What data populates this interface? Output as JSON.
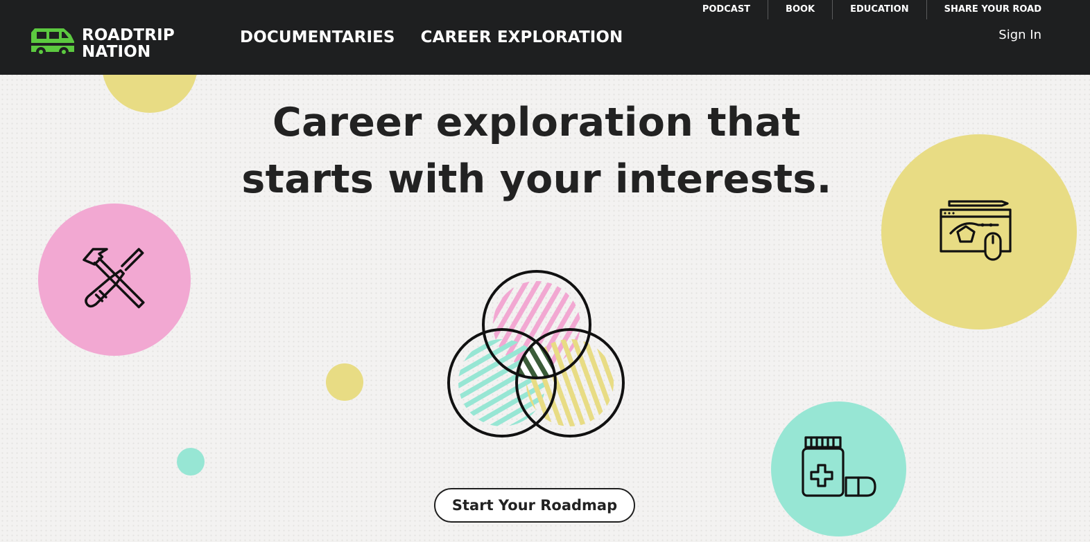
{
  "header": {
    "logo": {
      "line1": "ROADTRIP",
      "line2": "NATION",
      "icon": "van-icon",
      "icon_color": "#5cc940"
    },
    "main_nav": [
      "DOCUMENTARIES",
      "CAREER EXPLORATION"
    ],
    "utility_nav": [
      "PODCAST",
      "BOOK",
      "EDUCATION",
      "SHARE YOUR ROAD"
    ],
    "sign_in": "Sign In",
    "background": "#1e1f20"
  },
  "hero": {
    "headline_line1": "Career exploration that",
    "headline_line2": "starts with your interests.",
    "cta_label": "Start Your Roadmap"
  },
  "icons": {
    "left": "hammer-screwdriver-icon",
    "right": "design-software-icon",
    "bottom_right": "medicine-bottle-icon",
    "center": "venn-diagram-icon"
  },
  "colors": {
    "pink": "#f2a8d2",
    "yellow": "#e8dc84",
    "teal": "#97e6d4",
    "dark_green": "#3b5c38",
    "text": "#222222",
    "page_background": "#f3f2f1"
  }
}
